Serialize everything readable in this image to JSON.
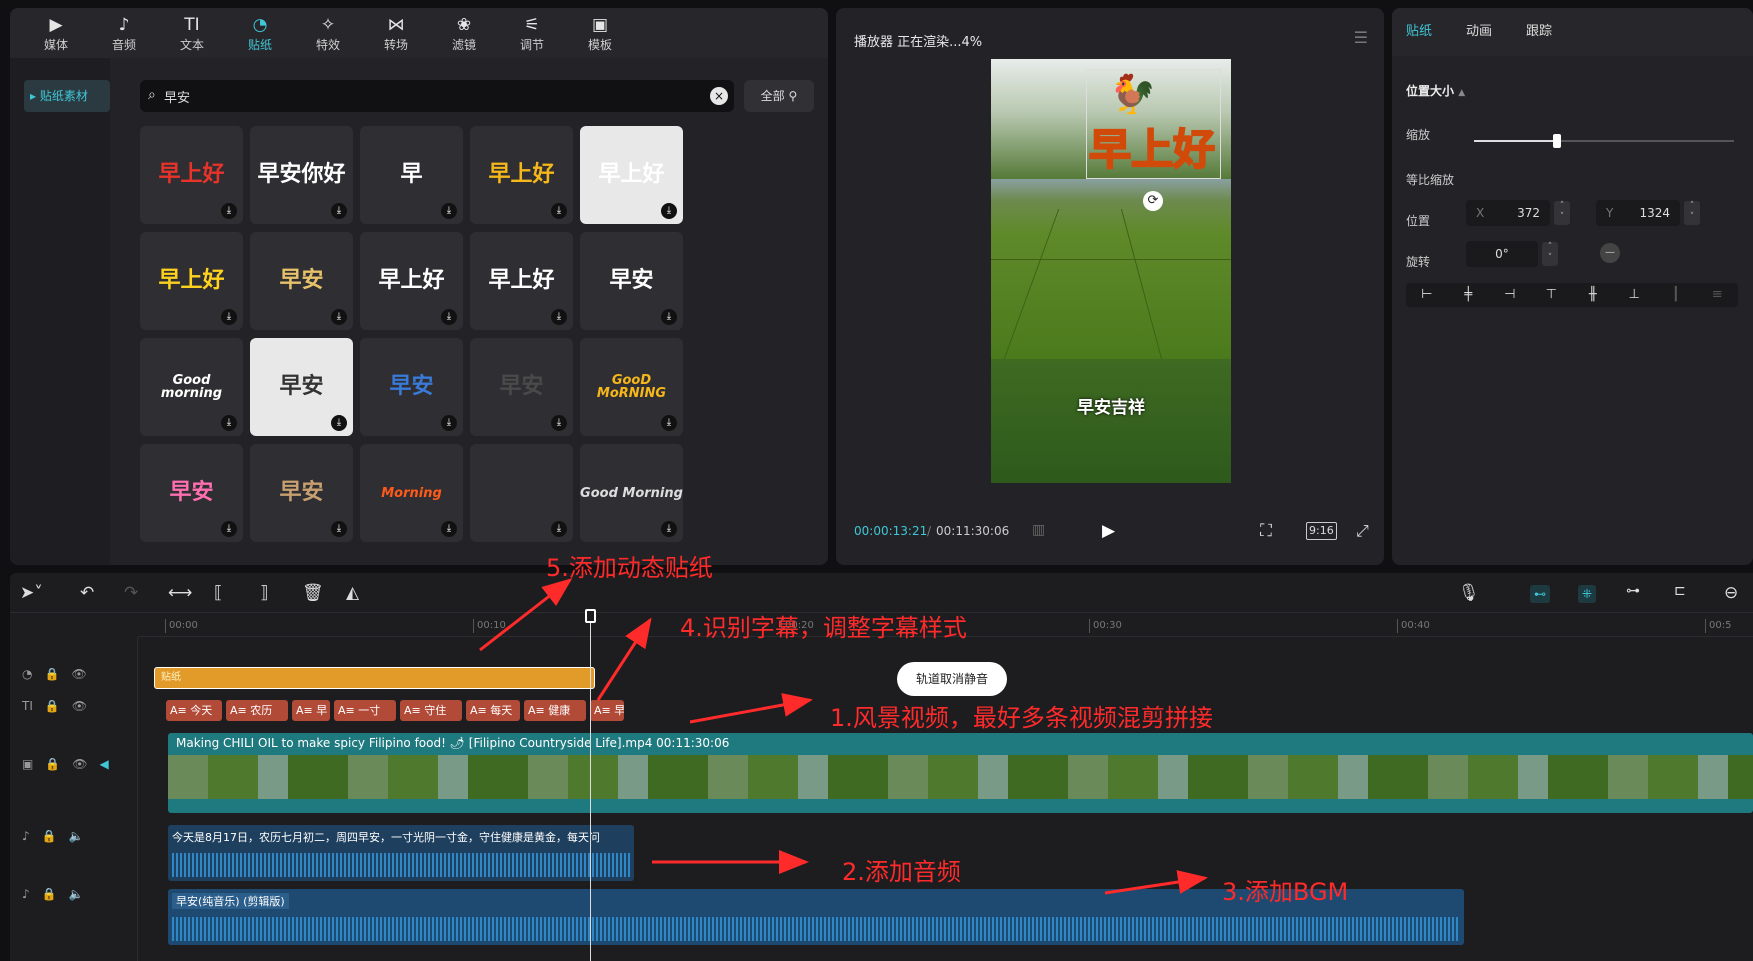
{
  "library": {
    "tabs": [
      {
        "label": "媒体",
        "icon": "media-icon",
        "glyph": "▶"
      },
      {
        "label": "音频",
        "icon": "audio-icon",
        "glyph": "♪"
      },
      {
        "label": "文本",
        "icon": "text-icon",
        "glyph": "TI"
      },
      {
        "label": "贴纸",
        "icon": "sticker-icon",
        "glyph": "◔"
      },
      {
        "label": "特效",
        "icon": "effects-icon",
        "glyph": "✧"
      },
      {
        "label": "转场",
        "icon": "transition-icon",
        "glyph": "⋈"
      },
      {
        "label": "滤镜",
        "icon": "filter-icon",
        "glyph": "❀"
      },
      {
        "label": "调节",
        "icon": "adjust-icon",
        "glyph": "⚟"
      },
      {
        "label": "模板",
        "icon": "template-icon",
        "glyph": "▣"
      }
    ],
    "side_item": "贴纸素材",
    "search_value": "早安",
    "filter_label": "全部",
    "stickers": [
      {
        "text": "早上好",
        "color": "#e8332a"
      },
      {
        "text": "早安你好",
        "color": "#ffffff"
      },
      {
        "text": "早",
        "color": "#ffffff"
      },
      {
        "text": "早上好",
        "color": "#f5b71a"
      },
      {
        "text": "早上好",
        "color": "#ffffff"
      },
      {
        "text": "早上好",
        "color": "#ffd21e"
      },
      {
        "text": "早安",
        "color": "#e8c26a"
      },
      {
        "text": "早上好",
        "color": "#ffffff"
      },
      {
        "text": "早上好",
        "color": "#ffffff"
      },
      {
        "text": "早安",
        "color": "#ffffff"
      },
      {
        "text": "Good morning",
        "color": "#ffffff"
      },
      {
        "text": "早安",
        "color": "#333333"
      },
      {
        "text": "早安",
        "color": "#3a7ad8"
      },
      {
        "text": "早安",
        "color": "#4a4a4a"
      },
      {
        "text": "GooD MoRNING",
        "color": "#f5b71a"
      },
      {
        "text": "早安",
        "color": "#ff6fb0"
      },
      {
        "text": "早安",
        "color": "#c8a070"
      },
      {
        "text": "Morning",
        "color": "#ff5a1a"
      },
      {
        "text": "",
        "color": "#ffffff"
      },
      {
        "text": "Good Morning",
        "color": "#dddddd"
      }
    ]
  },
  "player": {
    "title": "播放器 正在渲染...4%",
    "subtitle": "早安吉祥",
    "current_time": "00:00:13:21",
    "separator": "/",
    "total_time": "00:11:30:06",
    "ratio": "9:16"
  },
  "props": {
    "tabs": [
      "贴纸",
      "动画",
      "跟踪"
    ],
    "section": "位置大小",
    "scale_label": "缩放",
    "scale_fraction": 0.32,
    "lock_ratio_label": "等比缩放",
    "position_label": "位置",
    "x_axis": "X",
    "x_value": "372",
    "y_axis": "Y",
    "y_value": "1324",
    "rotate_label": "旋转",
    "rotate_value": "0°"
  },
  "timeline": {
    "ticks": [
      "00:00",
      "00:10",
      "00:20",
      "00:30",
      "00:40",
      "00:5"
    ],
    "sticker_clip_label": "贴纸",
    "text_clips": [
      "今天",
      "农历",
      "早",
      "一寸",
      "守住",
      "每天",
      "健康",
      "早"
    ],
    "video_title": "Making CHILI OIL to make spicy Filipino food! 🌶 [Filipino Countryside Life].mp4   00:11:30:06",
    "voice_title": "今天是8月17日，农历七月初二，周四早安，一寸光阴一寸金，守住健康是黄金，每天问",
    "bgm_title": "早安(纯音乐) (剪辑版)",
    "tooltip": "轨道取消静音"
  },
  "annotations": {
    "a1": "1.风景视频，最好多条视频混剪拼接",
    "a2": "2.添加音频",
    "a3": "3.添加BGM",
    "a4": "4.识别字幕，调整字幕样式",
    "a5": "5.添加动态贴纸"
  },
  "colors": {
    "accent": "#3fc7d6",
    "annotation": "#ff2a2a",
    "sticker_clip": "#e29a28",
    "video_clip": "#1f7a80",
    "audio_clip": "#1e3f5e"
  }
}
